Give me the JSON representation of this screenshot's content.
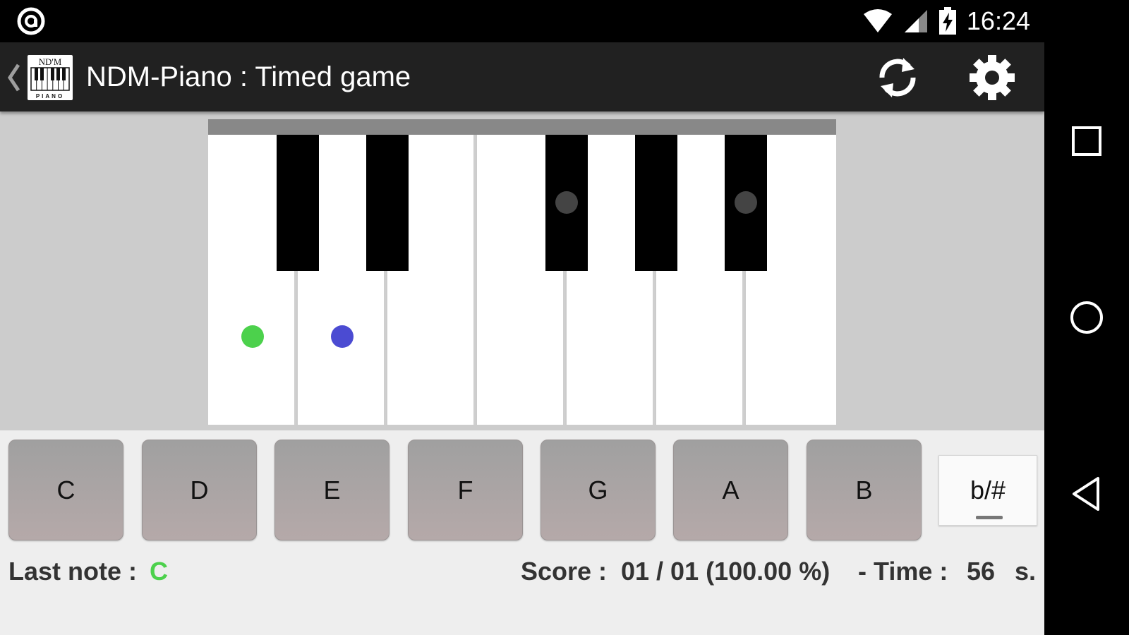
{
  "status_bar": {
    "time": "16:24",
    "app_icon": "notification-circle-icon",
    "icons": [
      "wifi-icon",
      "cell-signal-icon",
      "battery-charging-icon"
    ]
  },
  "action_bar": {
    "title": "NDM-Piano : Timed game",
    "logo_text": "ND'M",
    "logo_subtext": "PIANO",
    "actions": [
      "refresh-icon",
      "settings-gear-icon"
    ]
  },
  "keyboard": {
    "white_keys": 7,
    "black_keys": [
      "C#",
      "D#",
      "F#",
      "G#",
      "A#"
    ],
    "dots": [
      {
        "key": "C",
        "color": "#4cd14c"
      },
      {
        "key": "D",
        "color": "#4b4bd2"
      },
      {
        "key": "F#",
        "color": "#444444"
      },
      {
        "key": "A#",
        "color": "#444444"
      }
    ]
  },
  "note_buttons": [
    "C",
    "D",
    "E",
    "F",
    "G",
    "A",
    "B"
  ],
  "accidental_toggle": "b/#",
  "info": {
    "last_note_label": "Last note :",
    "last_note_value": "C",
    "last_note_color": "#4cd14c",
    "score_label": "Score :",
    "score_value": "01 / 01 (100.00 %)",
    "time_label": "- Time :",
    "time_value": "56",
    "time_unit": "s."
  },
  "nav_bar": [
    "recents-square-icon",
    "home-circle-icon",
    "back-triangle-icon"
  ]
}
